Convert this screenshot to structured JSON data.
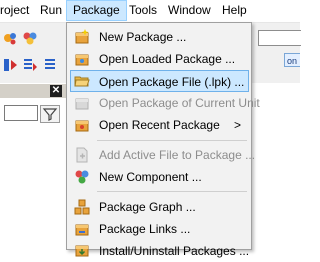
{
  "menubar": {
    "items": [
      "roject",
      "Run",
      "Package",
      "Tools",
      "Window",
      "Help"
    ]
  },
  "right_strip": {
    "pill_text": "on"
  },
  "panel": {
    "close_glyph": "✕",
    "filter_glyph": "⏷"
  },
  "package_menu": {
    "items": [
      {
        "label": "New Package ...",
        "icon": "new-package-icon",
        "enabled": true
      },
      {
        "label": "Open Loaded Package ...",
        "icon": "open-loaded-package-icon",
        "enabled": true
      },
      {
        "label": "Open Package File (.lpk) ...",
        "icon": "open-folder-icon",
        "enabled": true,
        "highlighted": true
      },
      {
        "label": "Open Package of Current Unit",
        "icon": "package-current-unit-icon",
        "enabled": false
      },
      {
        "label": "Open Recent Package",
        "icon": "recent-package-icon",
        "enabled": true,
        "submenu": true
      },
      {
        "label": "Add Active File to Package ...",
        "icon": "add-file-icon",
        "enabled": false
      },
      {
        "label": "New Component ...",
        "icon": "new-component-icon",
        "enabled": true
      },
      {
        "label": "Package Graph ...",
        "icon": "package-graph-icon",
        "enabled": true
      },
      {
        "label": "Package Links ...",
        "icon": "package-links-icon",
        "enabled": true
      },
      {
        "label": "Install/Uninstall Packages ...",
        "icon": "install-packages-icon",
        "enabled": true
      }
    ],
    "submenu_arrow": ">"
  }
}
